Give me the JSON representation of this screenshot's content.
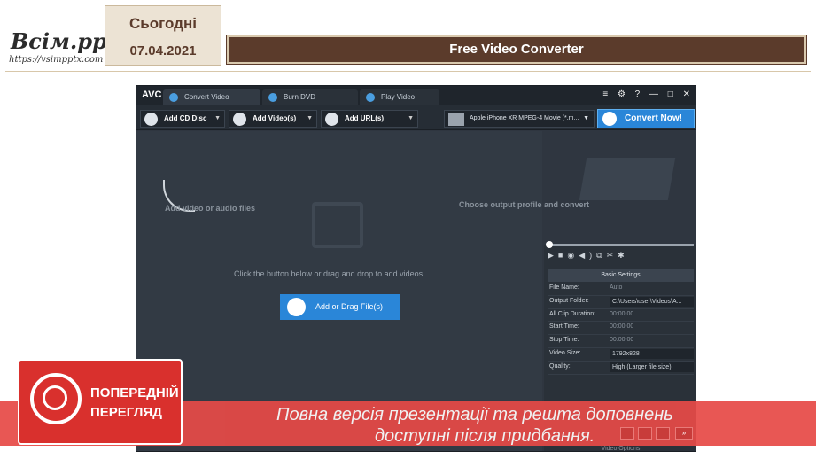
{
  "slide": {
    "logo_text": "Всім.pptx",
    "logo_url": "https://vsimpptx.com",
    "date_label": "Сьогодні",
    "date": "07.04.2021",
    "title": "Free Video Converter"
  },
  "app": {
    "brand": "AVC",
    "tabs": [
      "Convert Video",
      "Burn DVD",
      "Play Video"
    ],
    "window_controls": "≡ ⚙ ? — □ ✕",
    "toolbar": {
      "add_cd": "Add CD Disc",
      "add_video": "Add Video(s)",
      "add_url": "Add URL(s)",
      "profile": "Apple iPhone XR MPEG-4 Movie (*.m...",
      "convert": "Convert Now!"
    },
    "main": {
      "hint_add": "Add video or audio files",
      "hint_click": "Click the button below or drag and drop to add videos.",
      "add_file_button": "Add or Drag File(s)"
    },
    "preview_hint": "Choose output profile and convert",
    "basic_settings": {
      "header": "Basic Settings",
      "rows": [
        {
          "label": "File Name:",
          "value": "Auto"
        },
        {
          "label": "Output Folder:",
          "value": "C:\\Users\\user\\Videos\\A..."
        },
        {
          "label": "All Clip Duration:",
          "value": "00:00:00"
        },
        {
          "label": "Start Time:",
          "value": "00:00:00"
        },
        {
          "label": "Stop Time:",
          "value": "00:00:00"
        },
        {
          "label": "Video Size:",
          "value": "1792x828"
        },
        {
          "label": "Quality:",
          "value": "High (Larger file size)"
        }
      ],
      "video_options": "Video Options"
    }
  },
  "banner": {
    "preview_line1": "ПОПЕРЕДНІЙ",
    "preview_line2": "ПЕРЕГЛЯД",
    "text_line1": "Повна версія презентації та решта доповнень",
    "text_line2": "доступні після придбання."
  }
}
